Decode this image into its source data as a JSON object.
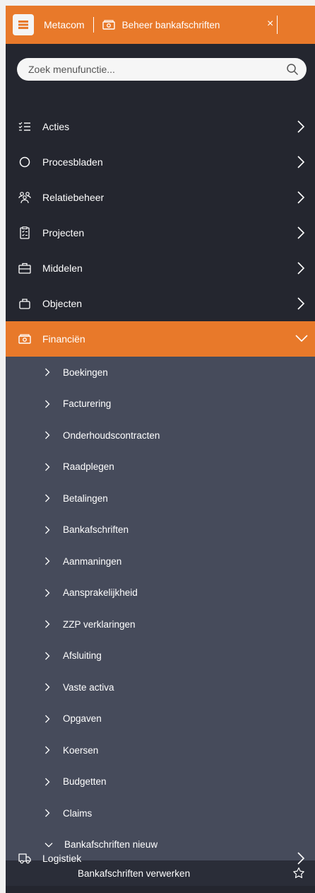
{
  "header": {
    "brand": "Metacom",
    "tab_title": "Beheer bankafschriften",
    "close_symbol": "×"
  },
  "search": {
    "placeholder": "Zoek menufunctie..."
  },
  "menu": [
    {
      "label": "Acties",
      "icon": "checklist-icon"
    },
    {
      "label": "Procesbladen",
      "icon": "circle-icon"
    },
    {
      "label": "Relatiebeheer",
      "icon": "people-icon"
    },
    {
      "label": "Projecten",
      "icon": "clipboard-icon"
    },
    {
      "label": "Middelen",
      "icon": "toolbox-icon"
    },
    {
      "label": "Objecten",
      "icon": "bag-icon"
    },
    {
      "label": "Financiën",
      "icon": "money-icon",
      "expanded": true
    }
  ],
  "submenu": [
    {
      "label": "Boekingen"
    },
    {
      "label": "Facturering"
    },
    {
      "label": "Onderhoudscontracten"
    },
    {
      "label": "Raadplegen"
    },
    {
      "label": "Betalingen"
    },
    {
      "label": "Bankafschriften"
    },
    {
      "label": "Aanmaningen"
    },
    {
      "label": "Aansprakelijkheid"
    },
    {
      "label": "ZZP verklaringen"
    },
    {
      "label": "Afsluiting"
    },
    {
      "label": "Vaste activa"
    },
    {
      "label": "Opgaven"
    },
    {
      "label": "Koersen"
    },
    {
      "label": "Budgetten"
    },
    {
      "label": "Claims"
    },
    {
      "label": "Bankafschriften nieuw",
      "expanded": true
    }
  ],
  "leaf": {
    "label": "Bankafschriften verwerken"
  },
  "bottom_menu": [
    {
      "label": "Logistiek",
      "icon": "truck-icon"
    }
  ],
  "colors": {
    "accent": "#e8792a",
    "sidebar_bg": "#24262f",
    "submenu_bg": "#464b5b"
  }
}
